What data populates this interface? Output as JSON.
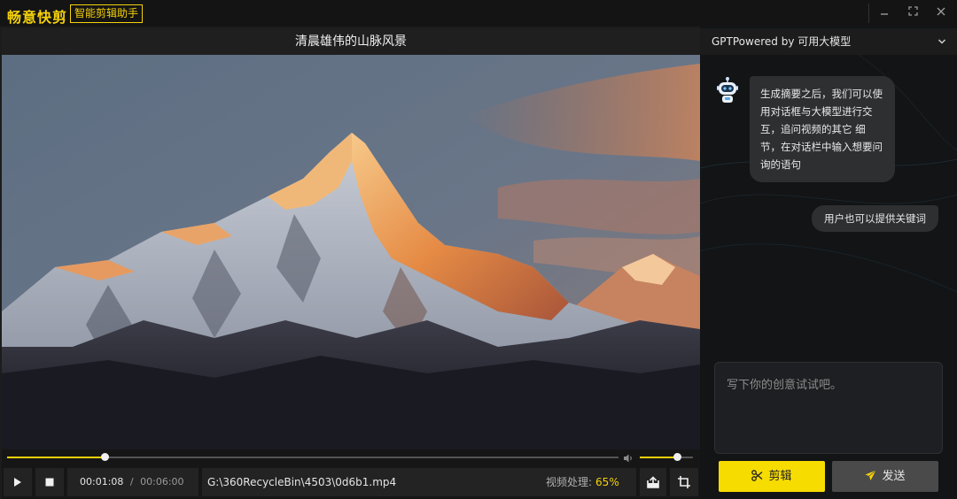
{
  "app": {
    "brand": "畅意快剪",
    "subtitle": "智能剪辑助手"
  },
  "window_controls": {
    "minimize_icon": "minimize-icon",
    "maximize_icon": "maximize-icon",
    "close_icon": "close-icon"
  },
  "video": {
    "title": "清晨雄伟的山脉风景",
    "progress": 0.16,
    "volume": 0.7,
    "current_time": "00:01:08",
    "separator": "/",
    "total_time": "00:06:00",
    "file_path": "G:\\360RecycleBin\\4503\\0d6b1.mp4",
    "processing_label": "视频处理:",
    "processing_percent": "65%"
  },
  "side": {
    "model_label": "GPTPowered by 可用大模型",
    "messages": [
      {
        "role": "bot",
        "text": "生成摘要之后，我们可以使用对话框与大模型进行交互，追问视频的其它 细节，在对话栏中输入想要问询的语句"
      },
      {
        "role": "user",
        "text": "用户也可以提供关键词"
      }
    ],
    "input_placeholder": "写下你的创意试试吧。",
    "cut_button": "剪辑",
    "send_button": "发送"
  },
  "colors": {
    "accent": "#f5d20a",
    "panel_bg": "#121416",
    "bubble_bg": "#2e2f31"
  }
}
